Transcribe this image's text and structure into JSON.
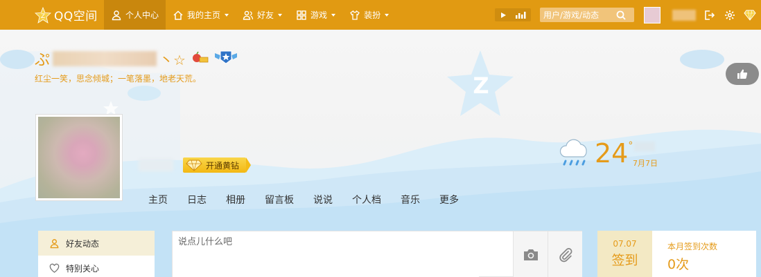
{
  "topbar": {
    "logo_text": "QQ空间",
    "nav": [
      {
        "label": "个人中心",
        "icon": "person-icon",
        "dropdown": false
      },
      {
        "label": "我的主页",
        "icon": "home-icon",
        "dropdown": true
      },
      {
        "label": "好友",
        "icon": "friends-icon",
        "dropdown": true
      },
      {
        "label": "游戏",
        "icon": "grid-icon",
        "dropdown": true
      },
      {
        "label": "装扮",
        "icon": "shirt-icon",
        "dropdown": true
      }
    ],
    "search_placeholder": "用户/游戏/动态",
    "colors": {
      "bar": "#e19a12",
      "active": "#c9870d"
    }
  },
  "profile": {
    "name_prefix": "ぷ",
    "name_suffix": "丶☆",
    "motto": "红尘一笑，思念倾城；一笔落墨，地老天荒。",
    "open_vip_label": "开通黄钻",
    "nav": [
      "主页",
      "日志",
      "相册",
      "留言板",
      "说说",
      "个人档",
      "音乐",
      "更多"
    ]
  },
  "weather": {
    "temperature": "24",
    "degree": "°",
    "date": "7月7日",
    "icon": "rain-cloud-icon"
  },
  "sidebar": {
    "items": [
      {
        "label": "好友动态",
        "icon": "person-icon"
      },
      {
        "label": "特别关心",
        "icon": "heart-icon"
      }
    ]
  },
  "composer": {
    "placeholder": "说点儿什么吧"
  },
  "checkin": {
    "date": "07.07",
    "label": "签到",
    "stats_label": "本月签到次数",
    "stats_value": "0次"
  },
  "accent_color": "#e59b1a"
}
